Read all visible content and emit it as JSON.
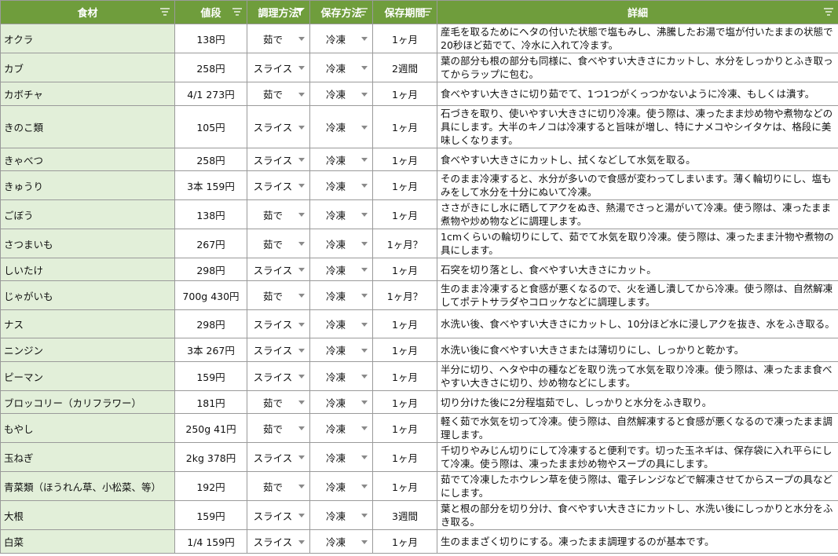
{
  "header": {
    "col_food": "食材",
    "col_price": "値段",
    "col_method": "調理方法",
    "col_storage": "保存方法",
    "col_period": "保存期間",
    "col_detail": "詳細"
  },
  "rows": [
    {
      "food": "オクラ",
      "price": "138円",
      "method": "茹で",
      "storage": "冷凍",
      "period": "1ヶ月",
      "detail": "産毛を取るためにヘタの付いた状態で塩もみし、沸騰したお湯で塩が付いたままの状態で20秒ほど茹でて、冷水に入れて冷ます。"
    },
    {
      "food": "カブ",
      "price": "258円",
      "method": "スライス",
      "storage": "冷凍",
      "period": "2週間",
      "detail": "葉の部分も根の部分も同様に、食べやすい大きさにカットし、水分をしっかりとふき取ってからラップに包む。"
    },
    {
      "food": "カボチャ",
      "price": "4/1 273円",
      "method": "茹で",
      "storage": "冷凍",
      "period": "1ヶ月",
      "detail": "食べやすい大きさに切り茹でて、1つ1つがくっつかないように冷凍、もしくは潰す。"
    },
    {
      "food": "きのこ類",
      "price": "105円",
      "method": "スライス",
      "storage": "冷凍",
      "period": "1ヶ月",
      "detail": "石づきを取り、使いやすい大きさに切り冷凍。使う際は、凍ったまま炒め物や煮物などの具にします。大半のキノコは冷凍すると旨味が増し、特にナメコやシイタケは、格段に美味しくなります。"
    },
    {
      "food": "きゃべつ",
      "price": "258円",
      "method": "スライス",
      "storage": "冷凍",
      "period": "1ヶ月",
      "detail": "食べやすい大きさにカットし、拭くなどして水気を取る。"
    },
    {
      "food": "きゅうり",
      "price": "3本 159円",
      "method": "スライス",
      "storage": "冷凍",
      "period": "1ヶ月",
      "detail": "そのまま冷凍すると、水分が多いので食感が変わってしまいます。薄く輪切りにし、塩もみをして水分を十分にぬいて冷凍。"
    },
    {
      "food": "ごぼう",
      "price": "138円",
      "method": "茹で",
      "storage": "冷凍",
      "period": "1ヶ月",
      "detail": "ささがきにし水に晒してアクをぬき、熱湯でさっと湯がいて冷凍。使う際は、凍ったまま煮物や炒め物などに調理します。"
    },
    {
      "food": "さつまいも",
      "price": "267円",
      "method": "茹で",
      "storage": "冷凍",
      "period": "1ヶ月？",
      "detail": "1cmくらいの輪切りにして、茹でて水気を取り冷凍。使う際は、凍ったまま汁物や煮物の具にします。"
    },
    {
      "food": "しいたけ",
      "price": "298円",
      "method": "スライス",
      "storage": "冷凍",
      "period": "1ヶ月",
      "detail": "石突を切り落とし、食べやすい大きさにカット。"
    },
    {
      "food": "じゃがいも",
      "price": "700g 430円",
      "method": "茹で",
      "storage": "冷凍",
      "period": "1ヶ月？",
      "detail": "生のまま冷凍すると食感が悪くなるので、火を通し潰してから冷凍。使う際は、自然解凍してポテトサラダやコロッケなどに調理します。"
    },
    {
      "food": "ナス",
      "price": "298円",
      "method": "スライス",
      "storage": "冷凍",
      "period": "1ヶ月",
      "detail": "水洗い後、食べやすい大きさにカットし、10分ほど水に浸しアクを抜き、水をふき取る。"
    },
    {
      "food": "ニンジン",
      "price": "3本 267円",
      "method": "スライス",
      "storage": "冷凍",
      "period": "1ヶ月",
      "detail": "水洗い後に食べやすい大きさまたは薄切りにし、しっかりと乾かす。"
    },
    {
      "food": "ピーマン",
      "price": "159円",
      "method": "スライス",
      "storage": "冷凍",
      "period": "1ヶ月",
      "detail": "半分に切り、ヘタや中の種などを取り洗って水気を取り冷凍。使う際は、凍ったまま食べやすい大きさに切り、炒め物などにします。"
    },
    {
      "food": "ブロッコリー（カリフラワー）",
      "price": "181円",
      "method": "茹で",
      "storage": "冷凍",
      "period": "1ヶ月",
      "detail": "切り分けた後に2分程塩茹でし、しっかりと水分をふき取り。"
    },
    {
      "food": "もやし",
      "price": "250g 41円",
      "method": "茹で",
      "storage": "冷凍",
      "period": "1ヶ月",
      "detail": "軽く茹で水気を切って冷凍。使う際は、自然解凍すると食感が悪くなるので凍ったまま調理します。"
    },
    {
      "food": "玉ねぎ",
      "price": "2kg 378円",
      "method": "スライス",
      "storage": "冷凍",
      "period": "1ヶ月",
      "detail": "千切りやみじん切りにして冷凍すると便利です。切った玉ネギは、保存袋に入れ平らにして冷凍。使う際は、凍ったまま炒め物やスープの具にします。"
    },
    {
      "food": "青菜類（ほうれん草、小松菜、等）",
      "price": "192円",
      "method": "茹で",
      "storage": "冷凍",
      "period": "1ヶ月",
      "detail": "茹でて冷凍したホウレン草を使う際は、電子レンジなどで解凍させてからスープの具などにします。"
    },
    {
      "food": "大根",
      "price": "159円",
      "method": "スライス",
      "storage": "冷凍",
      "period": "3週間",
      "detail": "葉と根の部分を切り分け、食べやすい大きさにカットし、水洗い後にしっかりと水分をふき取る。"
    },
    {
      "food": "白菜",
      "price": "1/4 159円",
      "method": "スライス",
      "storage": "冷凍",
      "period": "1ヶ月",
      "detail": "生のままざく切りにする。凍ったまま調理するのが基本です。"
    }
  ]
}
